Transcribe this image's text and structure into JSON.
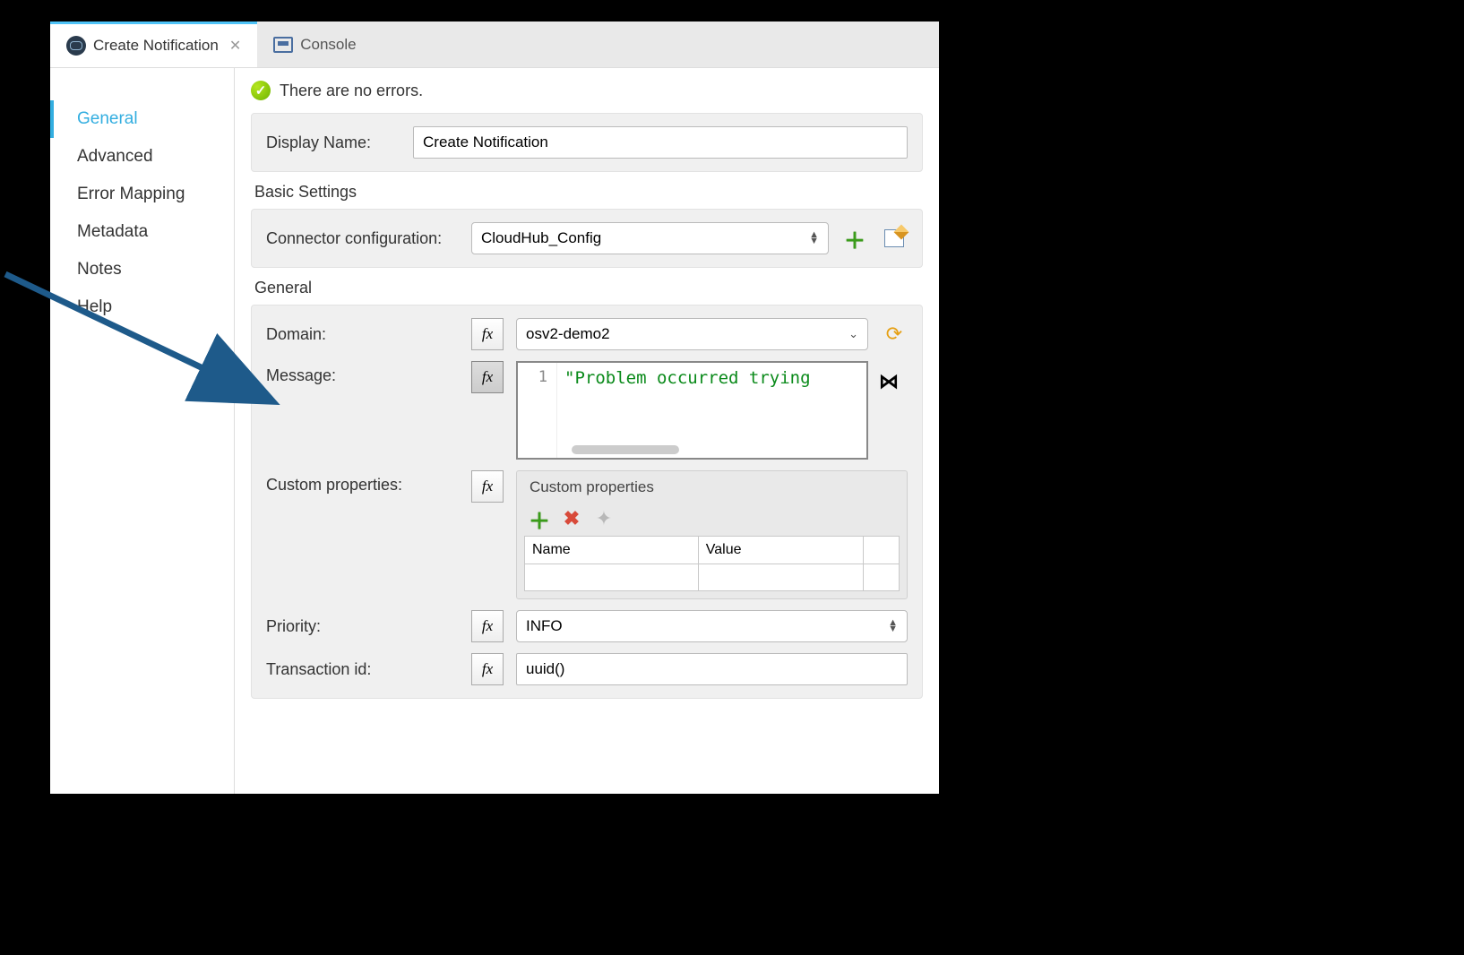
{
  "tabs": {
    "active": {
      "label": "Create Notification"
    },
    "console": {
      "label": "Console"
    }
  },
  "sidebar": {
    "items": [
      {
        "label": "General"
      },
      {
        "label": "Advanced"
      },
      {
        "label": "Error Mapping"
      },
      {
        "label": "Metadata"
      },
      {
        "label": "Notes"
      },
      {
        "label": "Help"
      }
    ]
  },
  "status": {
    "text": "There are no errors."
  },
  "displayName": {
    "label": "Display Name:",
    "value": "Create Notification"
  },
  "basicSettings": {
    "title": "Basic Settings",
    "connector": {
      "label": "Connector configuration:",
      "value": "CloudHub_Config"
    }
  },
  "general": {
    "title": "General",
    "domain": {
      "label": "Domain:",
      "value": "osv2-demo2"
    },
    "message": {
      "label": "Message:",
      "lineNumber": "1",
      "code": "\"Problem occurred trying"
    },
    "customProps": {
      "label": "Custom properties:",
      "panelTitle": "Custom properties",
      "columns": {
        "name": "Name",
        "value": "Value"
      }
    },
    "priority": {
      "label": "Priority:",
      "value": "INFO"
    },
    "transactionId": {
      "label": "Transaction id:",
      "value": "uuid()"
    }
  },
  "fx": "fx"
}
